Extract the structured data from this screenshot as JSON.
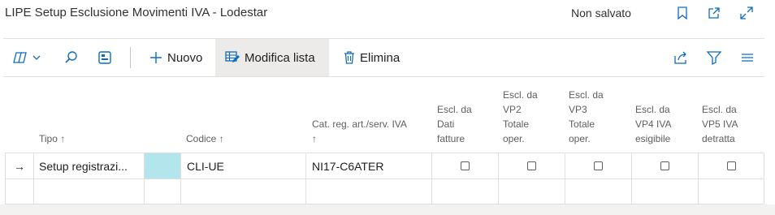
{
  "window": {
    "title": "LIPE Setup Esclusione Movimenti IVA - Lodestar",
    "status": "Non salvato"
  },
  "toolbar": {
    "new_label": "Nuovo",
    "edit_list_label": "Modifica lista",
    "delete_label": "Elimina"
  },
  "table": {
    "headers": {
      "tipo": "Tipo ↑",
      "codice": "Codice ↑",
      "cat_line1": "Cat. reg. art./serv. IVA",
      "cat_line2": "↑",
      "escl_dati": [
        "Escl. da",
        "Dati",
        "fatture"
      ],
      "escl_vp2": [
        "Escl. da",
        "VP2",
        "Totale",
        "oper."
      ],
      "escl_vp3": [
        "Escl. da",
        "VP3",
        "Totale",
        "oper."
      ],
      "escl_vp4": [
        "Escl. da",
        "VP4 IVA",
        "esigibile"
      ],
      "escl_vp5": [
        "Escl. da",
        "VP5 IVA",
        "detratta"
      ]
    },
    "rows": [
      {
        "indicator": "→",
        "tipo": "Setup registrazi...",
        "codice": "CLI-UE",
        "cat": "NI17-C6ATER"
      }
    ]
  }
}
